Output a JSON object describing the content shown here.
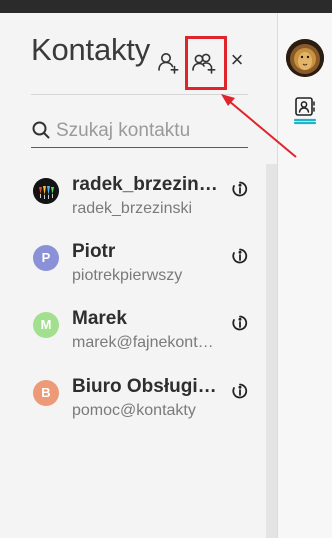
{
  "panel": {
    "title": "Kontakty",
    "close_label": "×",
    "header_icons": [
      "add-contact-icon",
      "add-group-icon",
      "close-icon"
    ]
  },
  "search": {
    "placeholder": "Szukaj kontaktu",
    "value": ""
  },
  "contacts": [
    {
      "name": "radek_brzezinski",
      "email": "radek_brzezinski",
      "avatar": "photo",
      "avatar_color": "#1e1e1e"
    },
    {
      "name": "Piotr",
      "email": "piotrekpierwszy",
      "avatar": "P",
      "avatar_color": "#8b91d6"
    },
    {
      "name": "Marek",
      "email": "marek@fajnekontakty",
      "avatar": "M",
      "avatar_color": "#a2df8e"
    },
    {
      "name": "Biuro Obsługi Klienta",
      "email": "pomoc@kontakty",
      "avatar": "B",
      "avatar_color": "#ec9a78"
    }
  ],
  "colors": {
    "highlight": "#e0242b",
    "accent": "#1fb5c9",
    "panel_bg": "#f4f4f4"
  }
}
